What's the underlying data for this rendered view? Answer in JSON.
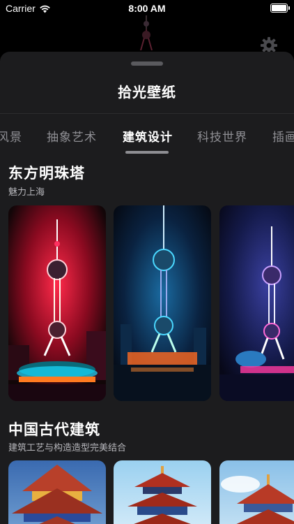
{
  "status_bar": {
    "carrier": "Carrier",
    "time": "8:00 AM"
  },
  "sheet": {
    "title": "拾光壁纸"
  },
  "tabs": [
    {
      "label": "风景",
      "active": false
    },
    {
      "label": "抽象艺术",
      "active": false
    },
    {
      "label": "建筑设计",
      "active": true
    },
    {
      "label": "科技世界",
      "active": false
    },
    {
      "label": "插画",
      "active": false
    }
  ],
  "sections": [
    {
      "title": "东方明珠塔",
      "subtitle": "魅力上海",
      "cards": [
        {
          "name": "oriental-pearl-red-wallpaper",
          "accent": "#e8183c"
        },
        {
          "name": "oriental-pearl-blue-wallpaper",
          "accent": "#1aa8d8"
        },
        {
          "name": "oriental-pearl-purple-wallpaper",
          "accent": "#8a5cff"
        }
      ]
    },
    {
      "title": "中国古代建筑",
      "subtitle": "建筑工艺与构造造型完美结合",
      "cards": [
        {
          "name": "chinese-pagoda-wallpaper-1"
        },
        {
          "name": "chinese-pagoda-wallpaper-2"
        },
        {
          "name": "chinese-pagoda-wallpaper-3"
        }
      ]
    }
  ],
  "icons": {
    "wifi": "wifi-icon",
    "battery": "battery-icon",
    "settings": "gear-icon"
  }
}
